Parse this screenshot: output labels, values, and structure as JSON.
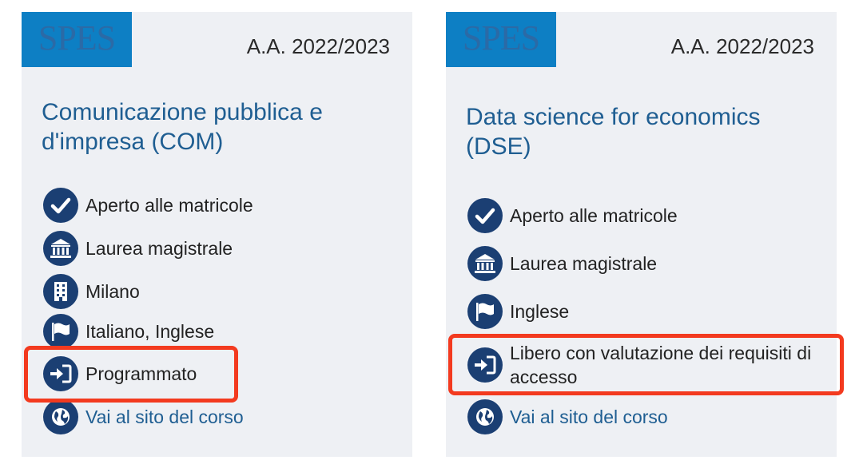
{
  "cards": [
    {
      "logo": "SPES",
      "year": "A.A. 2022/2023",
      "title": "Comunicazione pubblica e d'impresa (COM)",
      "items": [
        {
          "icon": "check-icon",
          "label": "Aperto alle matricole"
        },
        {
          "icon": "institution-icon",
          "label": "Laurea magistrale"
        },
        {
          "icon": "building-icon",
          "label": "Milano"
        },
        {
          "icon": "flag-icon",
          "label": "Italiano, Inglese"
        },
        {
          "icon": "sign-in-icon",
          "label": "Programmato"
        },
        {
          "icon": "globe-icon",
          "label": "Vai al sito del corso"
        }
      ]
    },
    {
      "logo": "SPES",
      "year": "A.A. 2022/2023",
      "title": "Data science for economics (DSE)",
      "items": [
        {
          "icon": "check-icon",
          "label": "Aperto alle matricole"
        },
        {
          "icon": "institution-icon",
          "label": "Laurea magistrale"
        },
        {
          "icon": "flag-icon",
          "label": "Inglese"
        },
        {
          "icon": "sign-in-icon",
          "label": "Libero con valutazione dei requisiti di accesso"
        },
        {
          "icon": "globe-icon",
          "label": "Vai al sito del corso"
        }
      ]
    }
  ],
  "colors": {
    "card_bg": "#eef0f4",
    "logo_bg": "#0d7fc4",
    "title": "#1f5e92",
    "icon_bg": "#1b3f73",
    "highlight": "#f33a1f"
  }
}
